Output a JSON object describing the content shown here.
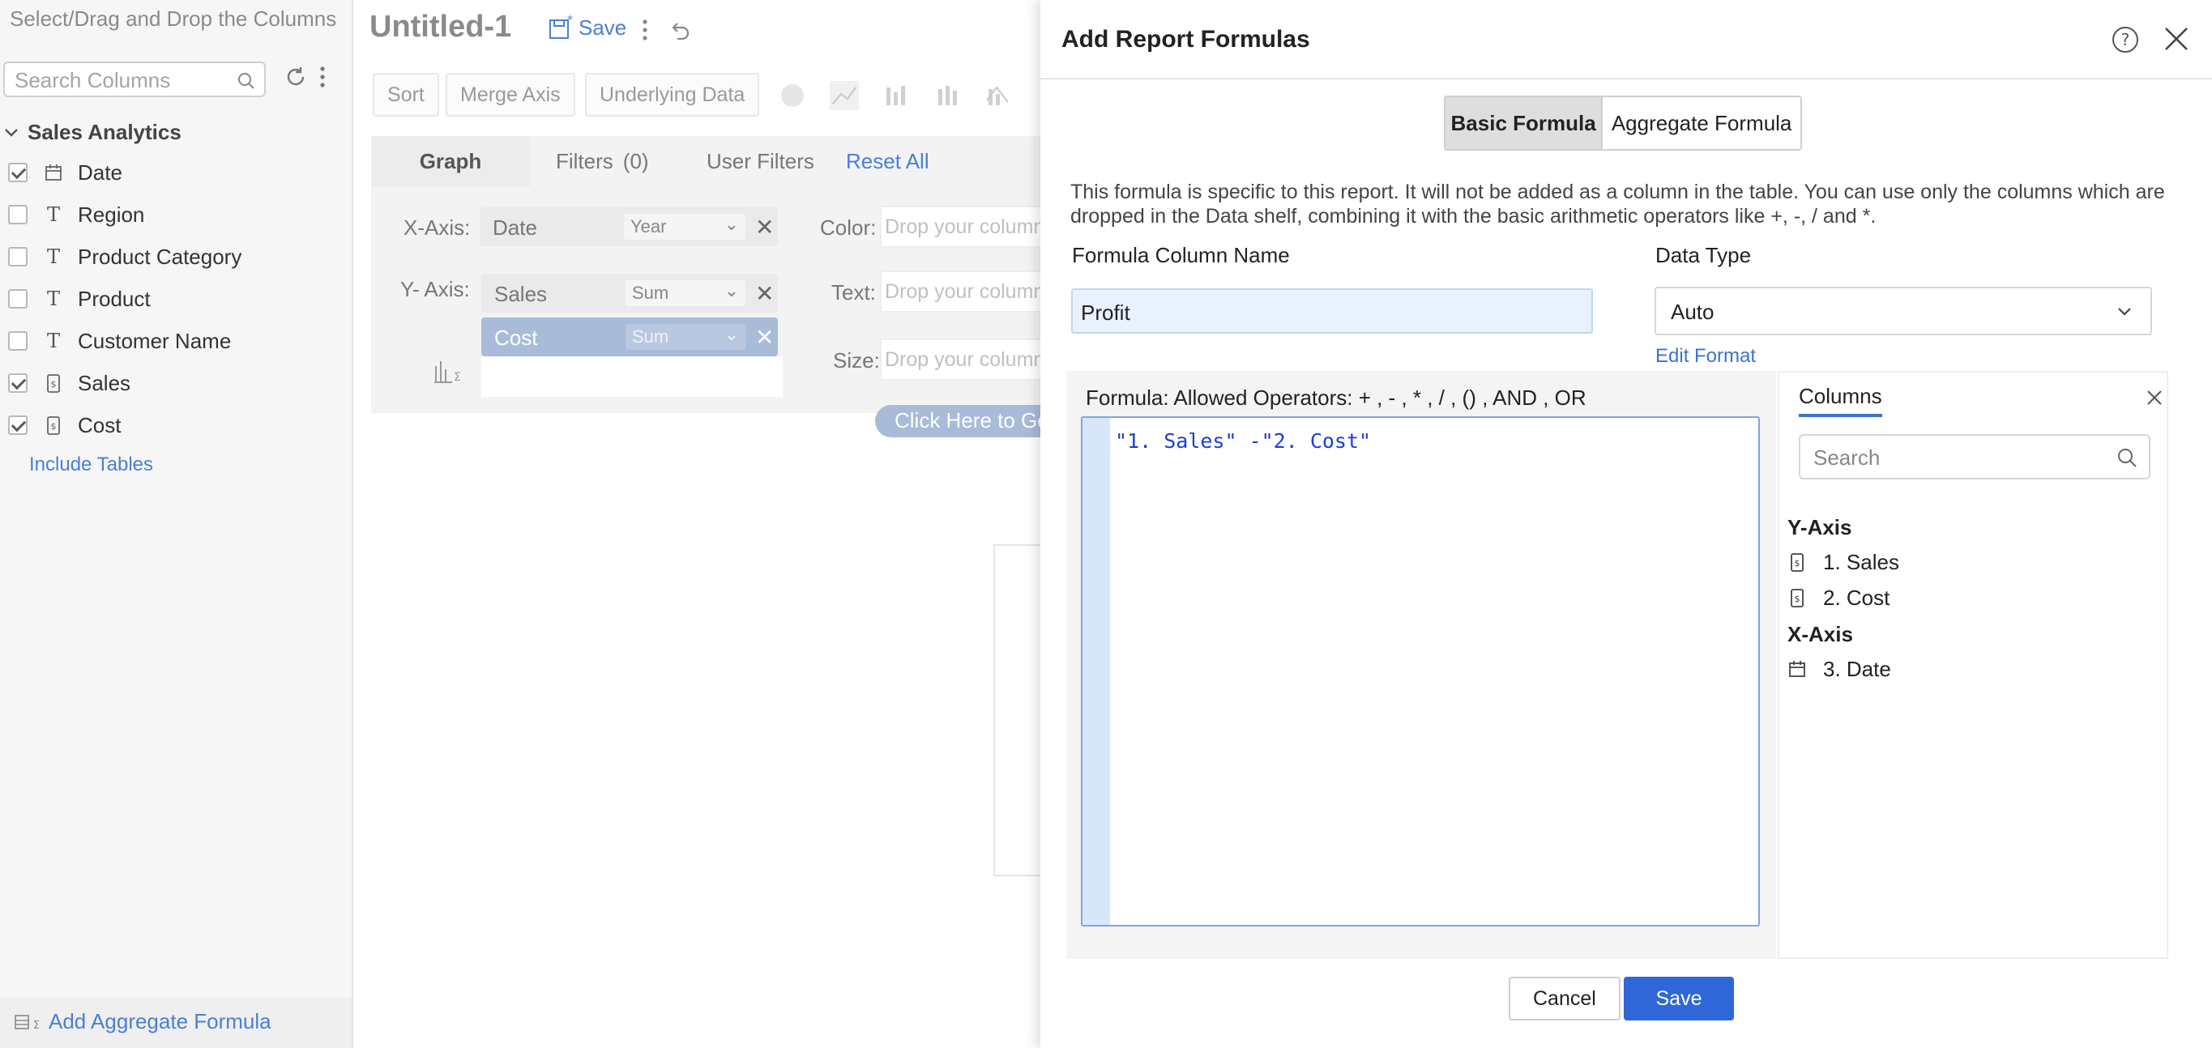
{
  "sidebar": {
    "title": "Select/Drag and Drop the Columns",
    "search_placeholder": "Search Columns",
    "group_name": "Sales Analytics",
    "columns": [
      {
        "label": "Date",
        "checked": true,
        "type_icon": "calendar-icon"
      },
      {
        "label": "Region",
        "checked": false,
        "type_icon": "text-type-icon"
      },
      {
        "label": "Product Category",
        "checked": false,
        "type_icon": "text-type-icon"
      },
      {
        "label": "Product",
        "checked": false,
        "type_icon": "text-type-icon"
      },
      {
        "label": "Customer Name",
        "checked": false,
        "type_icon": "text-type-icon"
      },
      {
        "label": "Sales",
        "checked": true,
        "type_icon": "numeric-type-icon"
      },
      {
        "label": "Cost",
        "checked": true,
        "type_icon": "numeric-type-icon"
      }
    ],
    "include_tables": "Include Tables",
    "add_aggregate": "Add Aggregate Formula"
  },
  "main": {
    "doc_title": "Untitled-1",
    "save_label": "Save",
    "toolbar": {
      "sort": "Sort",
      "merge_axis": "Merge Axis",
      "underlying": "Underlying Data"
    },
    "tabs": {
      "graph": "Graph",
      "filters": "Filters",
      "filters_count": "(0)",
      "user_filters": "User Filters",
      "reset_all": "Reset All"
    },
    "shelf": {
      "x_axis_label": "X-Axis:",
      "x_axis_field": "Date",
      "x_axis_agg": "Year",
      "y_axis_label": "Y- Axis:",
      "y_fields": [
        {
          "name": "Sales",
          "agg": "Sum"
        },
        {
          "name": "Cost",
          "agg": "Sum"
        }
      ],
      "color_label": "Color:",
      "text_label": "Text:",
      "size_label": "Size:",
      "drop_placeholder": "Drop your column"
    },
    "generate_button": "Click Here to Ge"
  },
  "dialog": {
    "title": "Add Report Formulas",
    "tab_basic": "Basic Formula",
    "tab_aggregate": "Aggregate Formula",
    "info_line1": "This formula is specific to this report. It will not be added as a column in the table. You can use only the columns which are",
    "info_line2": "dropped in the Data shelf, combining it with the basic arithmetic operators like +, -, / and *.",
    "formula_column_name_label": "Formula Column Name",
    "formula_column_name_value": "Profit",
    "data_type_label": "Data Type",
    "data_type_value": "Auto",
    "edit_format": "Edit Format",
    "formula_label": "Formula: Allowed Operators: + , - , * , / , () , AND , OR",
    "formula_code": "\"1. Sales\" -\"2. Cost\"",
    "columns_panel": {
      "tab": "Columns",
      "search_placeholder": "Search",
      "groups": [
        {
          "name": "Y-Axis",
          "items": [
            {
              "label": "1. Sales",
              "icon": "numeric-type-icon"
            },
            {
              "label": "2. Cost",
              "icon": "numeric-type-icon"
            }
          ]
        },
        {
          "name": "X-Axis",
          "items": [
            {
              "label": "3. Date",
              "icon": "calendar-icon"
            }
          ]
        }
      ]
    },
    "cancel": "Cancel",
    "save": "Save"
  },
  "colors": {
    "accent": "#2f67d8",
    "link": "#3b73cf",
    "editor_text": "#1a3fd6",
    "selected_pill": "#a8bbd8"
  }
}
